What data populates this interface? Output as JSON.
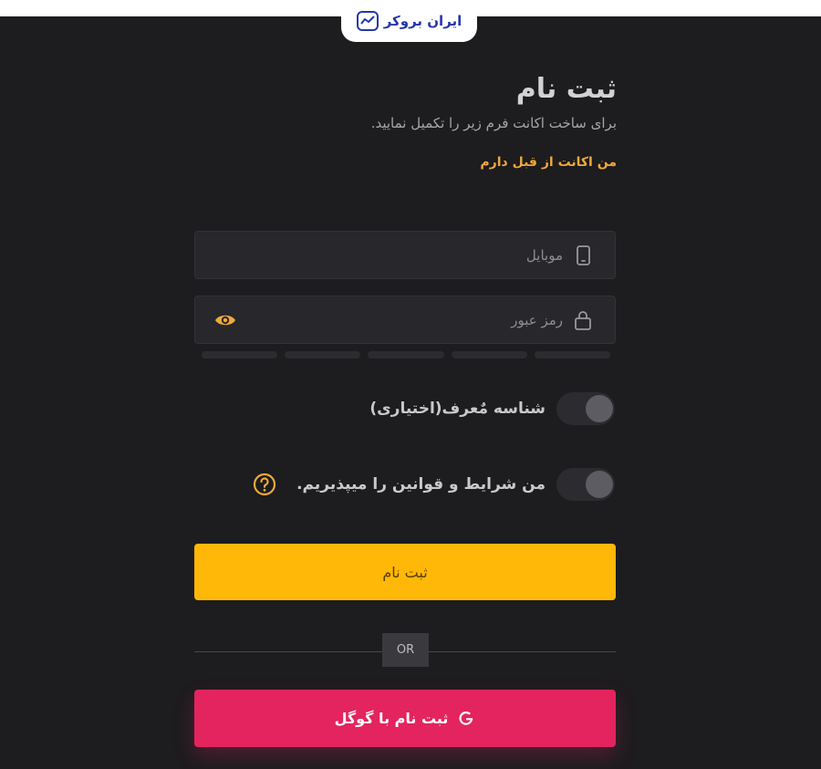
{
  "brand": {
    "logo_text": "ایران بروکر"
  },
  "header": {
    "title": "ثبت نام",
    "subtitle": "برای ساخت اکانت فرم زیر را تکمیل نمایید.",
    "login_link": "من اکانت از قبل دارم"
  },
  "form": {
    "mobile": {
      "placeholder": "موبایل",
      "value": "",
      "icon": "mobile-phone-icon"
    },
    "password": {
      "placeholder": "رمز عبور",
      "value": "",
      "icon": "lock-icon",
      "toggle_icon": "eye-icon"
    },
    "referral": {
      "label": "شناسه مٌعرف(اختیاری)",
      "enabled": false
    },
    "terms": {
      "label": "من شرایط و قوانین را میپذیریم.",
      "accepted": false,
      "help_icon": "question-circle-icon"
    },
    "submit_label": "ثبت نام",
    "divider_label": "OR",
    "google_label": "ثبت نام با گوگل",
    "google_icon": "google-g-icon"
  },
  "colors": {
    "background": "#1d1c1f",
    "accent_yellow": "#ffb708",
    "accent_orange": "#f0a93a",
    "google_pink": "#e3245f",
    "brand_blue": "#2638a8"
  }
}
